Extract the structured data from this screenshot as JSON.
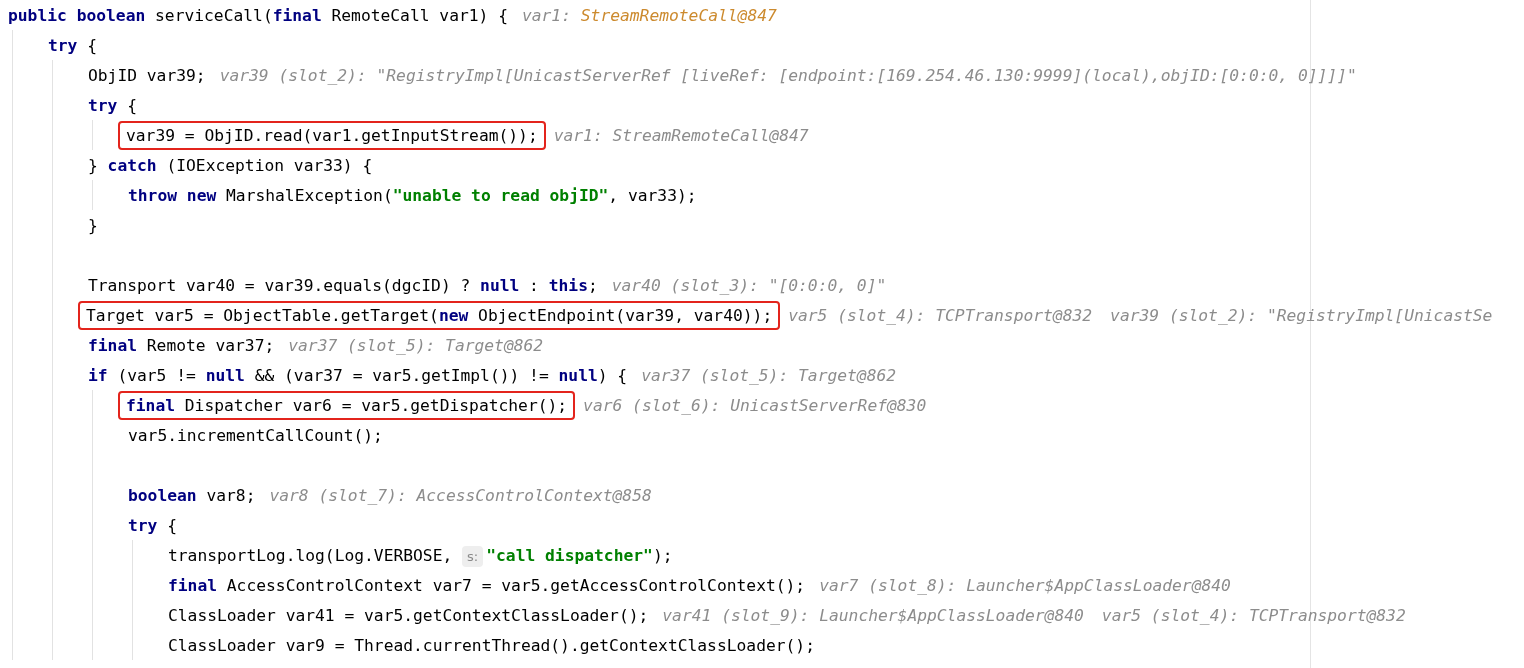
{
  "editor": {
    "lines": [
      {
        "kind": "code",
        "tokens": [
          {
            "kind": "keyword",
            "text": "public "
          },
          {
            "kind": "keyword",
            "text": "boolean"
          },
          {
            "kind": "plain",
            "text": " serviceCall("
          },
          {
            "kind": "keyword",
            "text": "final"
          },
          {
            "kind": "plain",
            "text": " RemoteCall var1) {"
          }
        ],
        "hints": [
          {
            "name": "var1:",
            "value": "StreamRemoteCall@847",
            "highlight": true
          }
        ],
        "children": [
          {
            "kind": "code",
            "tokens": [
              {
                "kind": "keyword",
                "text": "try"
              },
              {
                "kind": "plain",
                "text": " {"
              }
            ],
            "children": [
              {
                "kind": "code",
                "tokens": [
                  {
                    "kind": "plain",
                    "text": "ObjID var39;"
                  }
                ],
                "hints": [
                  {
                    "name": "var39 (slot_2):",
                    "value": "\"RegistryImpl[UnicastServerRef [liveRef: [endpoint:[169.254.46.130:9999](local),objID:[0:0:0, 0]]]]\"",
                    "highlight": false
                  }
                ]
              },
              {
                "kind": "code",
                "tokens": [
                  {
                    "kind": "keyword",
                    "text": "try"
                  },
                  {
                    "kind": "plain",
                    "text": " {"
                  }
                ],
                "children": [
                  {
                    "kind": "code",
                    "boxed": true,
                    "tokens": [
                      {
                        "kind": "plain",
                        "text": "var39 = ObjID.read(var1.getInputStream());"
                      }
                    ],
                    "hints": [
                      {
                        "name": "var1:",
                        "value": "StreamRemoteCall@847",
                        "highlight": false
                      }
                    ]
                  }
                ]
              },
              {
                "kind": "code",
                "tokens": [
                  {
                    "kind": "plain",
                    "text": "} "
                  },
                  {
                    "kind": "keyword",
                    "text": "catch"
                  },
                  {
                    "kind": "plain",
                    "text": " (IOException var33) {"
                  }
                ],
                "children": [
                  {
                    "kind": "code",
                    "tokens": [
                      {
                        "kind": "keyword",
                        "text": "throw "
                      },
                      {
                        "kind": "keyword",
                        "text": "new"
                      },
                      {
                        "kind": "plain",
                        "text": " MarshalException("
                      },
                      {
                        "kind": "string",
                        "text": "\"unable to read objID\""
                      },
                      {
                        "kind": "plain",
                        "text": ", var33);"
                      }
                    ]
                  }
                ]
              },
              {
                "kind": "code",
                "tokens": [
                  {
                    "kind": "plain",
                    "text": "}"
                  }
                ]
              },
              {
                "kind": "blank"
              },
              {
                "kind": "code",
                "tokens": [
                  {
                    "kind": "plain",
                    "text": "Transport var40 = var39.equals(dgcID) ? "
                  },
                  {
                    "kind": "keyword",
                    "text": "null"
                  },
                  {
                    "kind": "plain",
                    "text": " : "
                  },
                  {
                    "kind": "keyword",
                    "text": "this"
                  },
                  {
                    "kind": "plain",
                    "text": ";"
                  }
                ],
                "hints": [
                  {
                    "name": "var40 (slot_3):",
                    "value": "\"[0:0:0, 0]\"",
                    "highlight": false
                  }
                ]
              },
              {
                "kind": "code",
                "boxed": true,
                "tokens": [
                  {
                    "kind": "plain",
                    "text": "Target var5 = ObjectTable.getTarget("
                  },
                  {
                    "kind": "keyword",
                    "text": "new"
                  },
                  {
                    "kind": "plain",
                    "text": " ObjectEndpoint(var39, var40));"
                  }
                ],
                "hints": [
                  {
                    "name": "var5 (slot_4):",
                    "value": "TCPTransport@832",
                    "highlight": false
                  },
                  {
                    "name": "var39 (slot_2):",
                    "value": "\"RegistryImpl[UnicastSe",
                    "highlight": false
                  }
                ]
              },
              {
                "kind": "code",
                "tokens": [
                  {
                    "kind": "keyword",
                    "text": "final"
                  },
                  {
                    "kind": "plain",
                    "text": " Remote var37;"
                  }
                ],
                "hints": [
                  {
                    "name": "var37 (slot_5):",
                    "value": "Target@862",
                    "highlight": false
                  }
                ]
              },
              {
                "kind": "code",
                "tokens": [
                  {
                    "kind": "keyword",
                    "text": "if"
                  },
                  {
                    "kind": "plain",
                    "text": " (var5 != "
                  },
                  {
                    "kind": "keyword",
                    "text": "null"
                  },
                  {
                    "kind": "plain",
                    "text": " && (var37 = var5.getImpl()) != "
                  },
                  {
                    "kind": "keyword",
                    "text": "null"
                  },
                  {
                    "kind": "plain",
                    "text": ") {"
                  }
                ],
                "hints": [
                  {
                    "name": "var37 (slot_5):",
                    "value": "Target@862",
                    "highlight": false
                  }
                ],
                "children": [
                  {
                    "kind": "code",
                    "boxed": true,
                    "tokens": [
                      {
                        "kind": "keyword",
                        "text": "final"
                      },
                      {
                        "kind": "plain",
                        "text": " Dispatcher var6 = var5.getDispatcher();"
                      }
                    ],
                    "hints": [
                      {
                        "name": "var6 (slot_6):",
                        "value": "UnicastServerRef@830",
                        "highlight": false
                      }
                    ]
                  },
                  {
                    "kind": "code",
                    "tokens": [
                      {
                        "kind": "plain",
                        "text": "var5.incrementCallCount();"
                      }
                    ]
                  },
                  {
                    "kind": "blank"
                  },
                  {
                    "kind": "code",
                    "tokens": [
                      {
                        "kind": "keyword",
                        "text": "boolean"
                      },
                      {
                        "kind": "plain",
                        "text": " var8;"
                      }
                    ],
                    "hints": [
                      {
                        "name": "var8 (slot_7):",
                        "value": "AccessControlContext@858",
                        "highlight": false
                      }
                    ]
                  },
                  {
                    "kind": "code",
                    "tokens": [
                      {
                        "kind": "keyword",
                        "text": "try"
                      },
                      {
                        "kind": "plain",
                        "text": " {"
                      }
                    ],
                    "children": [
                      {
                        "kind": "code",
                        "tokens": [
                          {
                            "kind": "plain",
                            "text": "transportLog.log(Log.VERBOSE, "
                          },
                          {
                            "kind": "param",
                            "text": "s:"
                          },
                          {
                            "kind": "string",
                            "text": "\"call dispatcher\""
                          },
                          {
                            "kind": "plain",
                            "text": ");"
                          }
                        ]
                      },
                      {
                        "kind": "code",
                        "tokens": [
                          {
                            "kind": "keyword",
                            "text": "final"
                          },
                          {
                            "kind": "plain",
                            "text": " AccessControlContext var7 = var5.getAccessControlContext();"
                          }
                        ],
                        "hints": [
                          {
                            "name": "var7 (slot_8):",
                            "value": "Launcher$AppClassLoader@840",
                            "highlight": false
                          }
                        ]
                      },
                      {
                        "kind": "code",
                        "tokens": [
                          {
                            "kind": "plain",
                            "text": "ClassLoader var41 = var5.getContextClassLoader();"
                          }
                        ],
                        "hints": [
                          {
                            "name": "var41 (slot_9):",
                            "value": "Launcher$AppClassLoader@840",
                            "highlight": false
                          },
                          {
                            "name": "var5 (slot_4):",
                            "value": "TCPTransport@832",
                            "highlight": false
                          }
                        ]
                      },
                      {
                        "kind": "code",
                        "tokens": [
                          {
                            "kind": "plain",
                            "text": "ClassLoader var9 = Thread.currentThread().getContextClassLoader();"
                          }
                        ]
                      }
                    ]
                  }
                ]
              }
            ]
          }
        ]
      }
    ]
  }
}
